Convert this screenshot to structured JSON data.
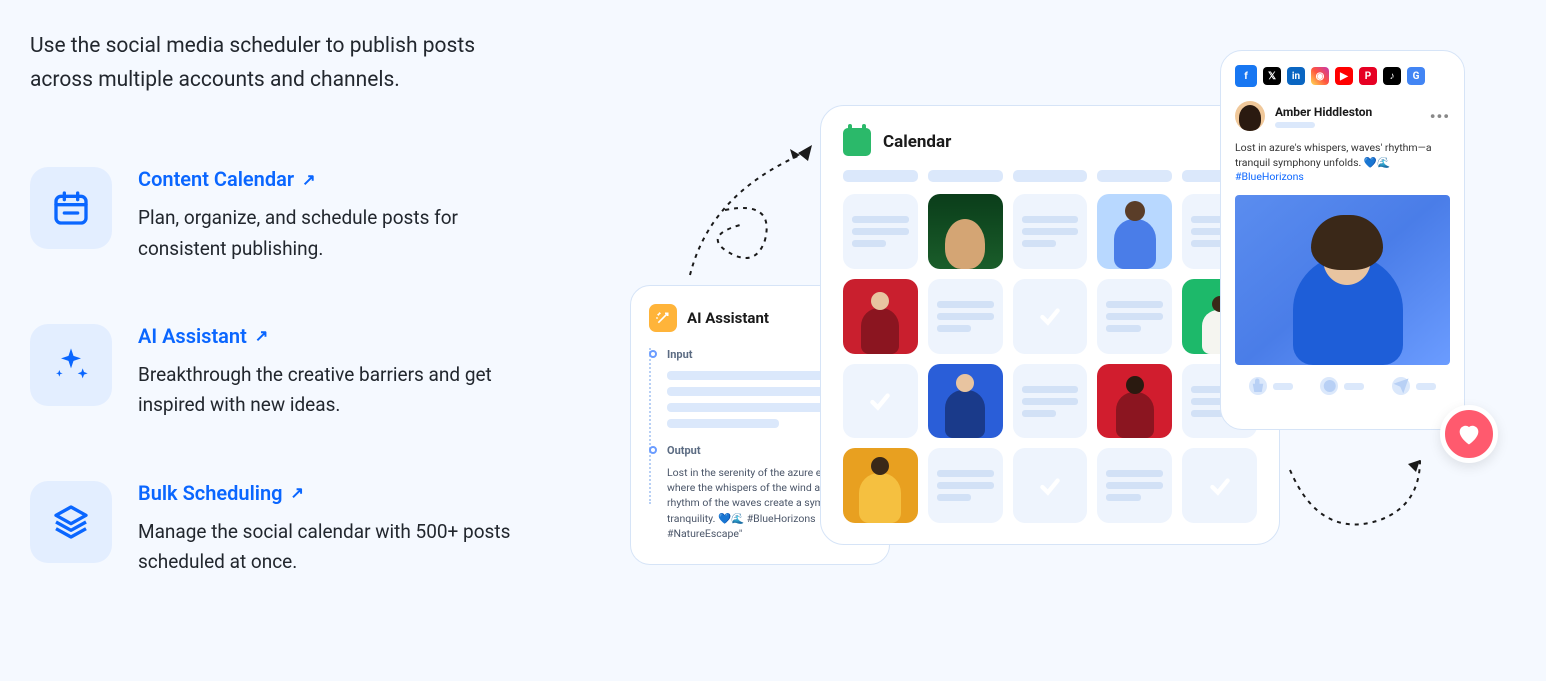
{
  "intro": "Use the social media scheduler to publish posts across multiple accounts and channels.",
  "features": [
    {
      "title": "Content Calendar",
      "desc": "Plan, organize, and schedule posts for consistent publishing."
    },
    {
      "title": "AI Assistant",
      "desc": "Breakthrough the creative barriers and get inspired with new ideas."
    },
    {
      "title": "Bulk Scheduling",
      "desc": "Manage the social calendar with 500+ posts scheduled at once."
    }
  ],
  "ai_card": {
    "title": "AI Assistant",
    "input_label": "Input",
    "output_label": "Output",
    "output_text": "Lost in the serenity of the azure expanse, where the whispers of the wind and the rhythm of the waves create a symphony of tranquility. 💙🌊 #BlueHorizons #NatureEscape\""
  },
  "calendar": {
    "title": "Calendar"
  },
  "post": {
    "username": "Amber Hiddleston",
    "caption_text": "Lost in azure's whispers, waves' rhythm—a tranquil symphony unfolds. 💙🌊 ",
    "caption_hashtag": "#BlueHorizons",
    "menu": "•••"
  },
  "social_networks": [
    "facebook",
    "x",
    "linkedin",
    "instagram",
    "youtube",
    "pinterest",
    "tiktok",
    "google"
  ]
}
